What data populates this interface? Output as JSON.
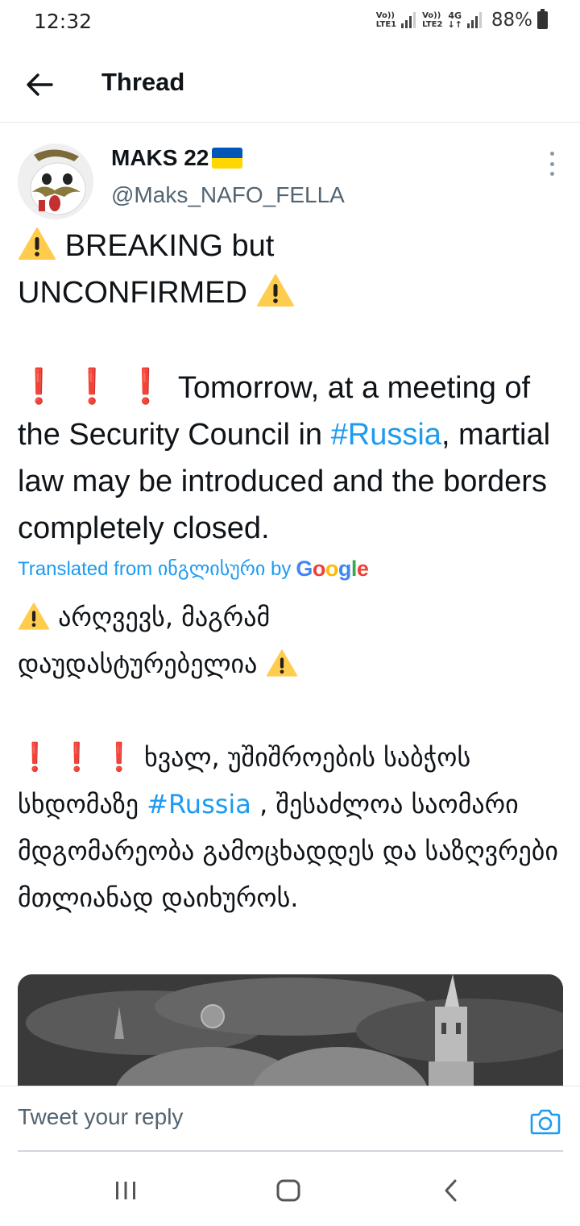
{
  "status_bar": {
    "time": "12:32",
    "sim1": "Vo)) LTE1",
    "sim2": "Vo)) LTE2",
    "network_type": "4G",
    "battery": "88%"
  },
  "header": {
    "title": "Thread",
    "back_icon": "arrow-left-icon"
  },
  "tweet": {
    "author_name": "MAKS 22",
    "author_flag": "ukraine-flag",
    "author_handle": "@Maks_NAFO_FELLA",
    "line1": "BREAKING but",
    "line2": "UNCONFIRMED",
    "body_part1": "Tomorrow, at a meeting of the Security Council in ",
    "hashtag": "#Russia",
    "body_part2": ", martial law may be introduced and the borders completely closed.",
    "translated_prefix": "Translated from ინგლისური by",
    "translated_by": "Google",
    "tr_line1": "არღვევს, მაგრამ",
    "tr_line2": "დაუდასტურებელია",
    "tr_body_part1": "ხვალ, უშიშროების საბჭოს სხდომაზე ",
    "tr_hashtag": "#Russia",
    "tr_body_part2": " , შესაძლოა საომარი მდგომარეობა გამოცხადდეს და საზღვრები მთლიანად დაიხუროს.",
    "exclamation": "❗"
  },
  "reply": {
    "placeholder": "Tweet your reply",
    "camera_icon": "camera-icon"
  },
  "nav": {
    "recents_icon": "recents-icon",
    "home_icon": "home-icon",
    "back_icon": "back-chevron-icon"
  },
  "colors": {
    "link": "#1d9bf0",
    "text": "#0f1419",
    "secondary": "#536471",
    "flag_blue": "#0057b7",
    "flag_yellow": "#ffd700"
  }
}
